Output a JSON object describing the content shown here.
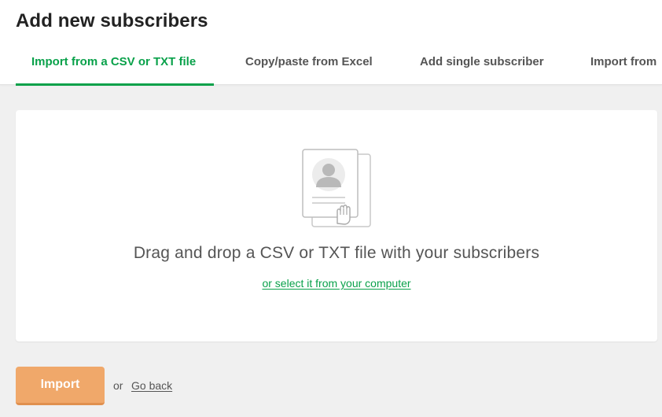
{
  "header": {
    "title": "Add new subscribers",
    "tabs": [
      {
        "label": "Import from a CSV or TXT file",
        "active": true
      },
      {
        "label": "Copy/paste from Excel",
        "active": false
      },
      {
        "label": "Add single subscriber",
        "active": false
      },
      {
        "label": "Import from",
        "active": false
      }
    ]
  },
  "dropzone": {
    "icon": "contact-card-drag-icon",
    "message": "Drag and drop a CSV or TXT file with your subscribers",
    "select_link": "or select it from your computer"
  },
  "footer": {
    "import_label": "Import",
    "or_label": "or",
    "go_back_label": "Go back"
  },
  "colors": {
    "accent_green": "#09a14a",
    "import_button": "#f0a86a",
    "background": "#f0f0f0"
  }
}
